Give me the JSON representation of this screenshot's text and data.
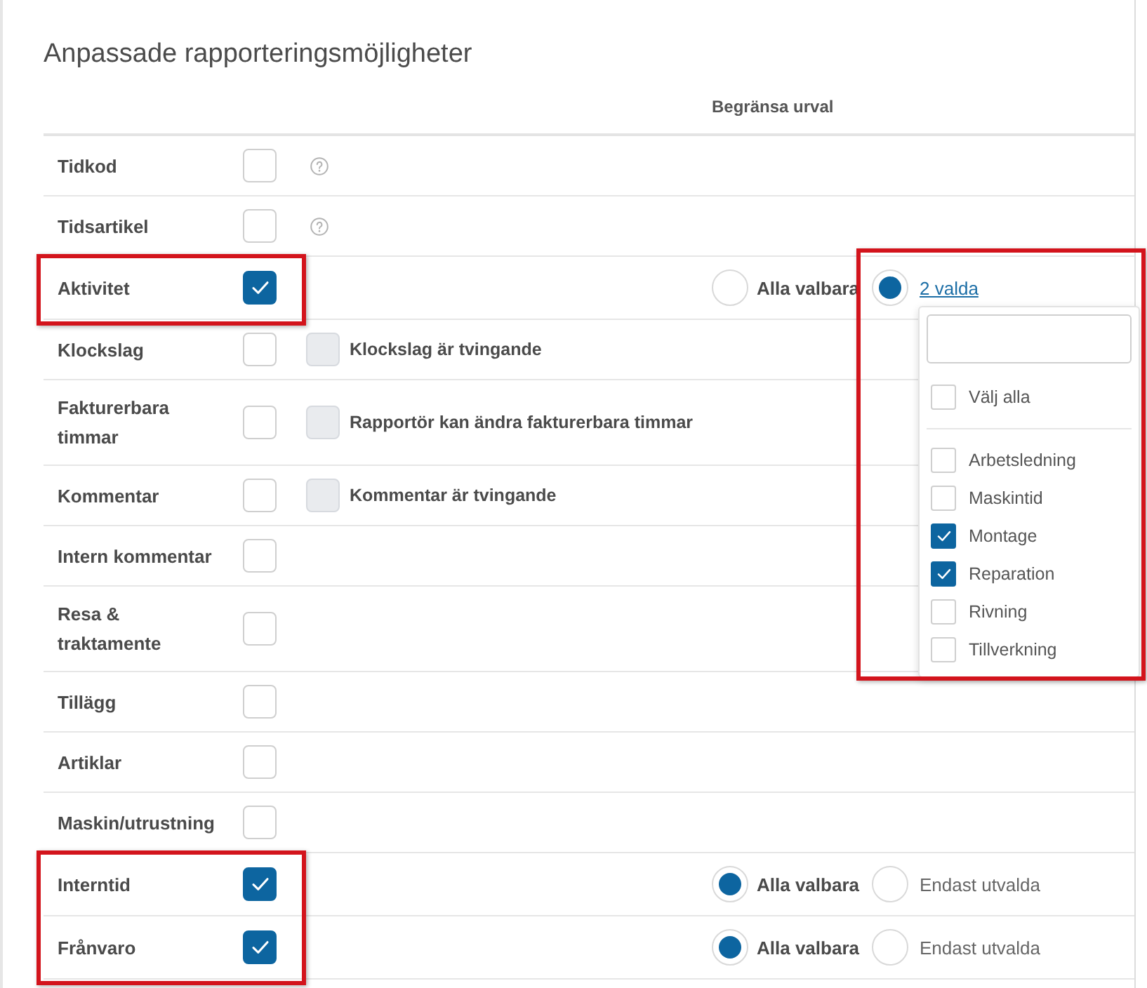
{
  "title": "Anpassade rapporteringsmöjligheter",
  "columns": {
    "restriction_header": "Begränsa urval"
  },
  "rows": [
    {
      "label": "Tidkod",
      "checked": false,
      "help": true,
      "highlighted": false
    },
    {
      "label": "Tidsartikel",
      "checked": false,
      "help": true,
      "highlighted": false
    },
    {
      "label": "Aktivitet",
      "checked": true,
      "help": false,
      "highlighted": true,
      "restriction": {
        "options": [
          {
            "kind": "all",
            "label": "Alla valbara",
            "selected": false
          },
          {
            "kind": "link",
            "label": "2 valda",
            "selected": true,
            "dropdown": {
              "expanded": true,
              "highlighted": true,
              "select_all": {
                "label": "Välj alla",
                "checked": false
              },
              "items": [
                {
                  "label": "Arbetsledning",
                  "checked": false
                },
                {
                  "label": "Maskintid",
                  "checked": false
                },
                {
                  "label": "Montage",
                  "checked": true
                },
                {
                  "label": "Reparation",
                  "checked": true
                },
                {
                  "label": "Rivning",
                  "checked": false
                },
                {
                  "label": "Tillverkning",
                  "checked": false
                }
              ]
            }
          }
        ]
      }
    },
    {
      "label": "Klockslag",
      "checked": false,
      "help": false,
      "highlighted": false,
      "sub_option": {
        "label": "Klockslag är tvingande",
        "checked": false,
        "disabled": true
      }
    },
    {
      "label": "Fakturerbara timmar",
      "checked": false,
      "help": false,
      "highlighted": false,
      "sub_option": {
        "label": "Rapportör kan ändra fakturerbara timmar",
        "checked": false,
        "disabled": true
      }
    },
    {
      "label": "Kommentar",
      "checked": false,
      "help": false,
      "highlighted": false,
      "sub_option": {
        "label": "Kommentar är tvingande",
        "checked": false,
        "disabled": true
      }
    },
    {
      "label": "Intern kommentar",
      "checked": false,
      "help": false,
      "highlighted": false
    },
    {
      "label": "Resa & traktamente",
      "checked": false,
      "help": false,
      "highlighted": false
    },
    {
      "label": "Tillägg",
      "checked": false,
      "help": false,
      "highlighted": false
    },
    {
      "label": "Artiklar",
      "checked": false,
      "help": false,
      "highlighted": false
    },
    {
      "label": "Maskin/utrustning",
      "checked": false,
      "help": false,
      "highlighted": false
    },
    {
      "label": "Interntid",
      "checked": true,
      "help": false,
      "highlighted": true,
      "restriction": {
        "options": [
          {
            "kind": "all",
            "label": "Alla valbara",
            "selected": true
          },
          {
            "kind": "only",
            "label": "Endast utvalda",
            "selected": false
          }
        ]
      }
    },
    {
      "label": "Frånvaro",
      "checked": true,
      "help": false,
      "highlighted": true,
      "restriction": {
        "options": [
          {
            "kind": "all",
            "label": "Alla valbara",
            "selected": true
          },
          {
            "kind": "only",
            "label": "Endast utvalda",
            "selected": false
          }
        ]
      }
    }
  ]
}
